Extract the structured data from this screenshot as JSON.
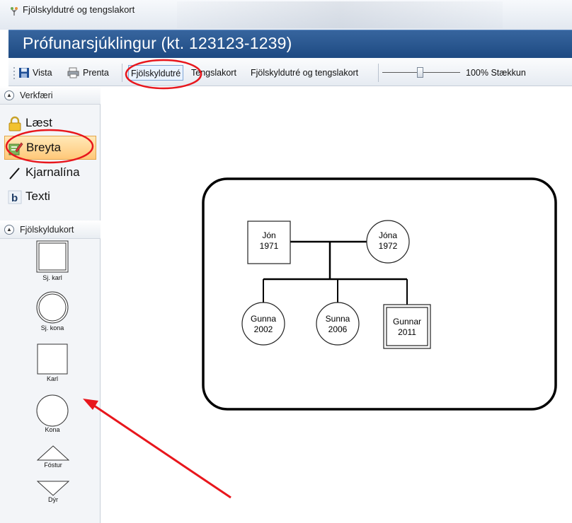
{
  "window": {
    "title": "Fjölskyldutré og tengslakort"
  },
  "header": {
    "title": "Prófunarsjúklingur (kt. 123123-1239)"
  },
  "toolbar": {
    "save_label": "Vista",
    "print_label": "Prenta",
    "tab_family_tree": "Fjölskyldutré",
    "tab_ecomap": "Tengslakort",
    "tab_both": "Fjölskyldutré og tengslakort",
    "zoom_label": "100% Stækkun",
    "zoom_level": 100
  },
  "sidebar": {
    "tools_header": "Verkfæri",
    "tools": [
      {
        "label": "Læst",
        "icon": "lock-icon"
      },
      {
        "label": "Breyta",
        "icon": "edit-icon",
        "selected": true
      },
      {
        "label": "Kjarnalína",
        "icon": "line-icon"
      },
      {
        "label": "Texti",
        "icon": "bold-text-icon"
      }
    ],
    "shapes_header": "Fjölskyldukort",
    "shapes": [
      {
        "label": "Sj. karl",
        "shape": "double-square"
      },
      {
        "label": "Sj. kona",
        "shape": "double-circle"
      },
      {
        "label": "Karl",
        "shape": "square"
      },
      {
        "label": "Kona",
        "shape": "circle"
      },
      {
        "label": "Fóstur",
        "shape": "triangle-up"
      },
      {
        "label": "Dýr",
        "shape": "triangle-down"
      }
    ]
  },
  "family_tree": {
    "father": {
      "name": "Jón",
      "year": "1971"
    },
    "mother": {
      "name": "Jóna",
      "year": "1972"
    },
    "children": [
      {
        "name": "Gunna",
        "year": "2002"
      },
      {
        "name": "Sunna",
        "year": "2006"
      },
      {
        "name": "Gunnar",
        "year": "2011"
      }
    ]
  },
  "colors": {
    "header_bg": "#1e4a82",
    "annotation_red": "#e8161c",
    "selected_tool_bg": "#ffc879"
  }
}
